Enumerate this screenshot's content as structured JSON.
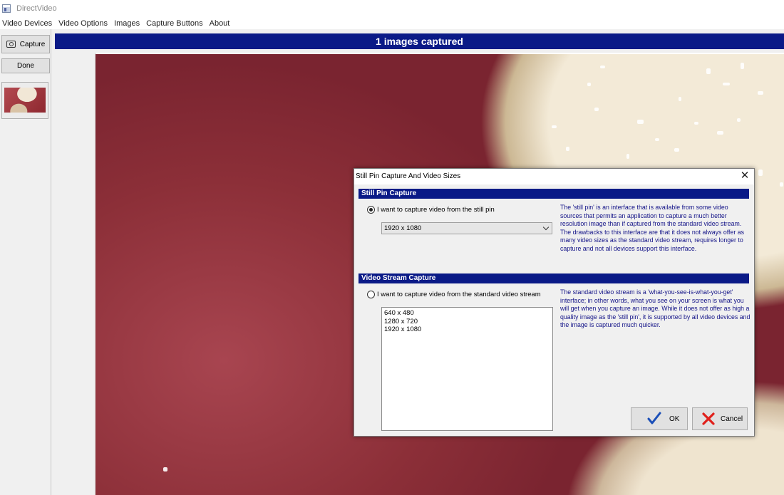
{
  "window": {
    "title": "DirectVideo",
    "icon": "app-window-icon"
  },
  "menu": {
    "items": [
      {
        "label": "Video Devices"
      },
      {
        "label": "Video Options"
      },
      {
        "label": "Images"
      },
      {
        "label": "Capture Buttons"
      },
      {
        "label": "About"
      }
    ]
  },
  "left_panel": {
    "capture_label": "Capture",
    "done_label": "Done",
    "capture_icon": "camera-icon"
  },
  "header": {
    "status": "1 images captured",
    "bg_color": "#0a1a87"
  },
  "dialog": {
    "title": "Still Pin Capture And Video Sizes",
    "still_pin": {
      "heading": "Still Pin Capture",
      "radio_label": "I want to capture video from the still pin",
      "selected": true,
      "dropdown_value": "1920 x 1080",
      "description": "The 'still pin' is an interface that is available from some video sources that permits an application to capture a much better resolution image than if captured from the standard video stream.  The drawbacks to this interface are that it does not always offer as many video sizes as the standard video stream, requires longer to capture and not all devices support this interface."
    },
    "video_stream": {
      "heading": "Video Stream Capture",
      "radio_label": "I want to capture video from the standard video stream",
      "selected": false,
      "sizes": [
        "640 x 480",
        "1280 x 720",
        "1920 x 1080"
      ],
      "description": "The standard video stream is a 'what-you-see-is-what-you-get' interface; in other words, what you see on your screen is what you will get when you capture an image.  While it does not offer as high a quality image as the 'still pin', it is supported by all video devices and the image is captured much quicker."
    },
    "ok_label": "OK",
    "cancel_label": "Cancel",
    "ok_icon": "checkmark-icon",
    "cancel_icon": "red-x-icon",
    "description_color": "#141488"
  }
}
